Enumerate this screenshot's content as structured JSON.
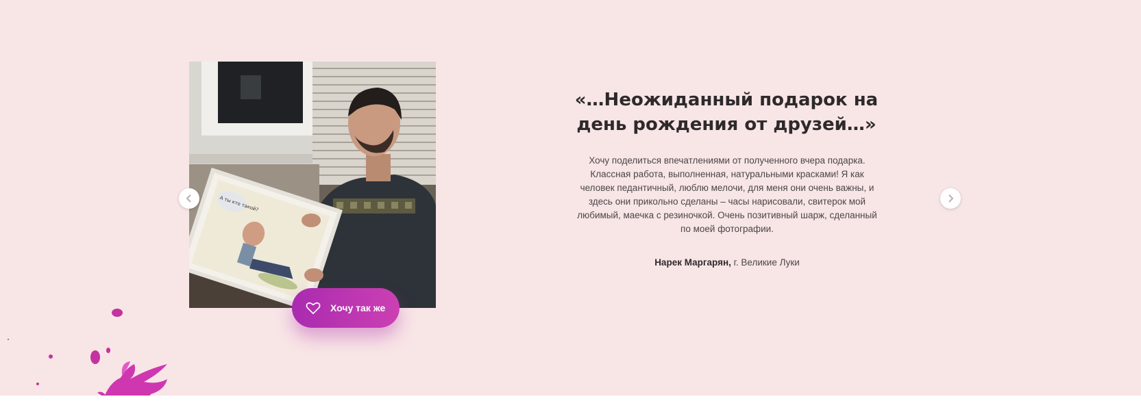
{
  "testimonial": {
    "title": "«…Неожиданный подарок на день рождения от друзей…»",
    "text": "Хочу поделиться впечатлениями от полученного вчера подарка. Классная работа, выполненная, натуральными красками! Я как человек педантичный, люблю мелочи, для меня они очень важны, и здесь они прикольно сделаны – часы нарисовали, свитерок мой любимый, маечка с резиночкой. Очень позитивный шарж, сделанный по моей фотографии.",
    "author_name": "Нарек Маргарян,",
    "author_city": "г. Великие Луки",
    "photo_caption": "А ты кто такой?"
  },
  "cta": {
    "label": "Хочу так же",
    "icon": "heart-outline-icon"
  },
  "carousel": {
    "prev_icon": "chevron-left-icon",
    "next_icon": "chevron-right-icon"
  },
  "colors": {
    "background": "#f8e5e6",
    "accent": "#b832b0",
    "text_dark": "#2e2a2b",
    "text_body": "#4a4647"
  }
}
